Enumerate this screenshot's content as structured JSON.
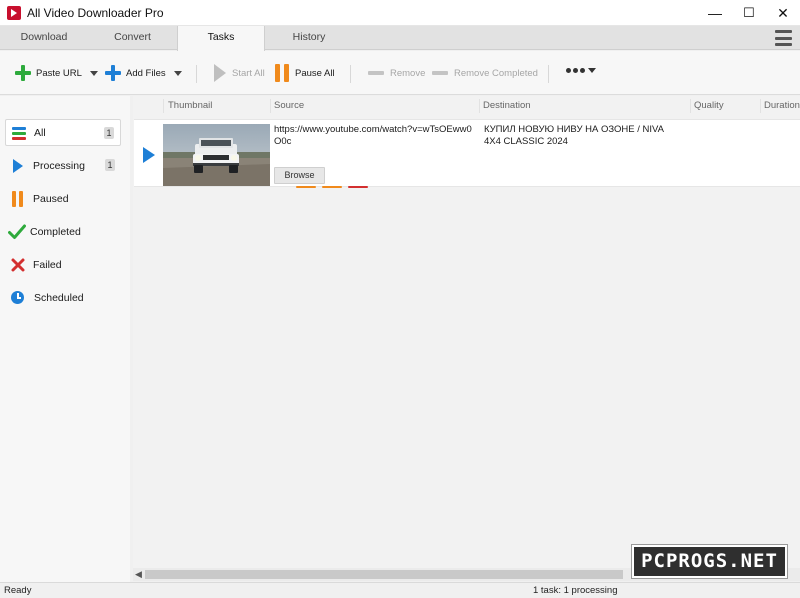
{
  "window": {
    "title": "All Video Downloader Pro",
    "controls": [
      "—",
      "☐",
      "✕"
    ]
  },
  "tabs": [
    {
      "label": "Download",
      "active": false
    },
    {
      "label": "Convert",
      "active": false
    },
    {
      "label": "Tasks",
      "active": true
    },
    {
      "label": "History",
      "active": false
    }
  ],
  "toolbar": {
    "paste_url": "Paste URL",
    "add_files": "Add Files",
    "start_all": "Start All",
    "pause_all": "Pause All",
    "remove": "Remove",
    "remove_completed": "Remove Completed"
  },
  "sidebar": {
    "items": [
      {
        "label": "All",
        "count": "1",
        "active": true,
        "icon": "list-icon"
      },
      {
        "label": "Processing",
        "count": "1",
        "active": false,
        "icon": "play-icon"
      },
      {
        "label": "Paused",
        "count": "",
        "active": false,
        "icon": "pause-icon"
      },
      {
        "label": "Completed",
        "count": "",
        "active": false,
        "icon": "checkmark-icon"
      },
      {
        "label": "Failed",
        "count": "",
        "active": false,
        "icon": "cross-icon"
      },
      {
        "label": "Scheduled",
        "count": "",
        "active": false,
        "icon": "clock-icon"
      }
    ]
  },
  "columns": [
    "Thumbnail",
    "Source",
    "Destination",
    "Quality",
    "Duration"
  ],
  "task": {
    "source": "https://www.youtube.com/watch?v=wTsOEww0O0c",
    "destination": "КУПИЛ НОВУЮ НИВУ НА ОЗОНЕ / NIVA 4X4 CLASSIC 2024",
    "browse_label": "Browse",
    "thumbnail": "white-niva-car-thumbnail"
  },
  "status": {
    "left": "Ready",
    "right": "1 task: 1 processing"
  },
  "watermark": "PCPROGS.NET",
  "colors": {
    "accent_blue": "#1e7fd6",
    "green": "#2eaa3c",
    "orange": "#f08a1c",
    "red": "#d32f2f"
  }
}
